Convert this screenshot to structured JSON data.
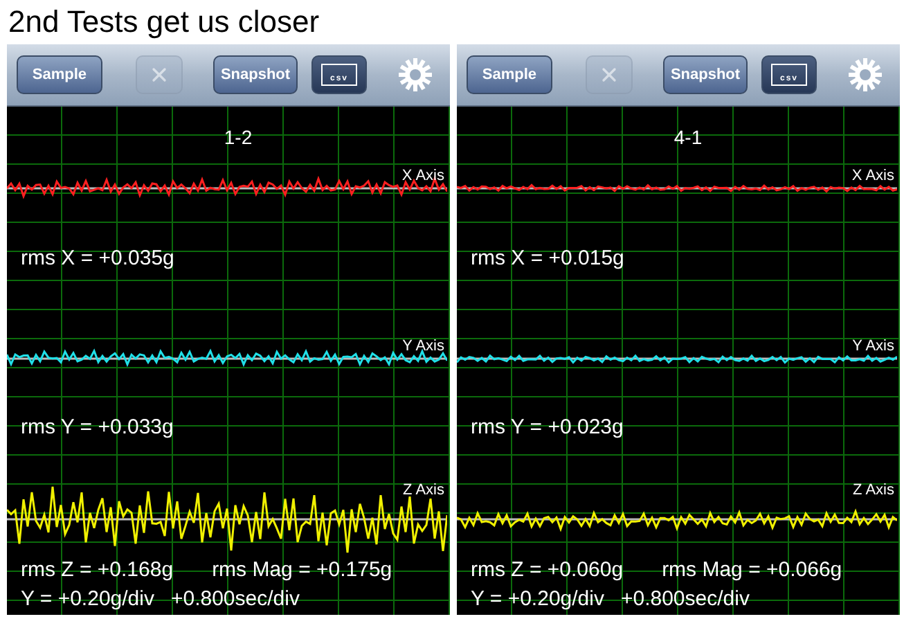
{
  "title": "2nd Tests get us closer",
  "panels": [
    {
      "toolbar": {
        "sample": "Sample",
        "clear_disabled": true,
        "snapshot": "Snapshot",
        "csv": "csv"
      },
      "caption": "1-2",
      "traces": [
        {
          "axis_label": "X Axis",
          "color": "#ff2020",
          "rms": "rms X = +0.035g"
        },
        {
          "axis_label": "Y Axis",
          "color": "#20e0e8",
          "rms": "rms Y = +0.033g"
        },
        {
          "axis_label": "Z Axis",
          "color": "#f0f000",
          "rms": "rms Z = +0.168g"
        }
      ],
      "rms_mag": "rms Mag = +0.175g",
      "scale": "Y = +0.20g/div",
      "time": "+0.800sec/div"
    },
    {
      "toolbar": {
        "sample": "Sample",
        "clear_disabled": true,
        "snapshot": "Snapshot",
        "csv": "csv"
      },
      "caption": "4-1",
      "traces": [
        {
          "axis_label": "X Axis",
          "color": "#ff2020",
          "rms": "rms X = +0.015g"
        },
        {
          "axis_label": "Y Axis",
          "color": "#20e0e8",
          "rms": "rms Y = +0.023g"
        },
        {
          "axis_label": "Z Axis",
          "color": "#f0f000",
          "rms": "rms Z = +0.060g"
        }
      ],
      "rms_mag": "rms Mag = +0.066g",
      "scale": "Y = +0.20g/div",
      "time": "+0.800sec/div"
    }
  ]
}
